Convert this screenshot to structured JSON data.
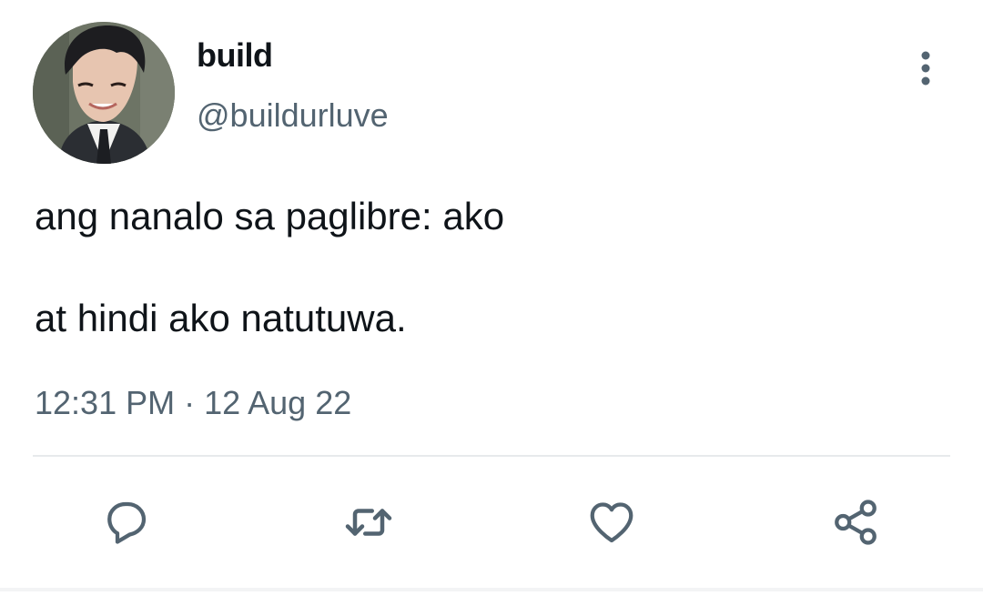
{
  "author": {
    "display_name": "build",
    "handle": "@buildurluve"
  },
  "tweet": {
    "lines": [
      "ang nanalo sa paglibre: ako",
      "at hindi ako natutuwa."
    ],
    "timestamp": "12:31 PM · 12 Aug 22"
  },
  "actions": [
    {
      "icon": "reply-icon"
    },
    {
      "icon": "retweet-icon"
    },
    {
      "icon": "like-icon"
    },
    {
      "icon": "share-icon"
    }
  ],
  "colors": {
    "text_primary": "#0f1419",
    "text_secondary": "#536471",
    "icon": "#536471",
    "divider": "#e7eaec"
  }
}
